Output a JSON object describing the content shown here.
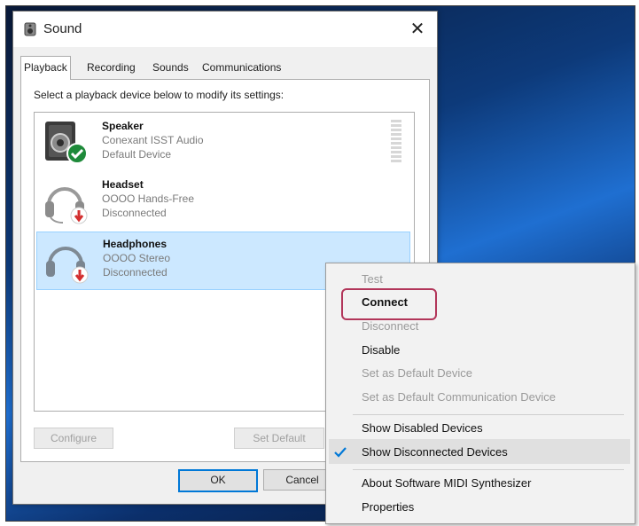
{
  "dialog": {
    "title": "Sound",
    "close_glyph": "✕",
    "tabs": [
      {
        "label": "Playback",
        "active": true
      },
      {
        "label": "Recording",
        "active": false
      },
      {
        "label": "Sounds",
        "active": false
      },
      {
        "label": "Communications",
        "active": false
      }
    ],
    "instruction": "Select a playback device below to modify its settings:",
    "devices": [
      {
        "name": "Speaker",
        "driver": "Conexant ISST Audio",
        "status": "Default Device",
        "icon": "speaker-icon",
        "badge": "default-check-badge",
        "selected": false
      },
      {
        "name": "Headset",
        "driver": "OOOO Hands-Free",
        "status": "Disconnected",
        "icon": "headset-icon",
        "badge": "disconnected-arrow-badge",
        "selected": false
      },
      {
        "name": "Headphones",
        "driver": "OOOO Stereo",
        "status": "Disconnected",
        "icon": "headphones-icon",
        "badge": "disconnected-arrow-badge",
        "selected": true
      }
    ],
    "buttons": {
      "configure": "Configure",
      "set_default": "Set Default",
      "ok": "OK",
      "cancel": "Cancel"
    }
  },
  "context_menu": {
    "items": [
      {
        "label": "Test",
        "state": "disabled"
      },
      {
        "label": "Connect",
        "state": "enabled",
        "highlighted": true
      },
      {
        "label": "Disconnect",
        "state": "disabled"
      },
      {
        "label": "Disable",
        "state": "enabled"
      },
      {
        "label": "Set as Default Device",
        "state": "disabled"
      },
      {
        "label": "Set as Default Communication Device",
        "state": "disabled"
      },
      {
        "label": "Show Disabled Devices",
        "state": "enabled"
      },
      {
        "label": "Show Disconnected Devices",
        "state": "checked"
      },
      {
        "label": "About Software MIDI Synthesizer",
        "state": "enabled"
      },
      {
        "label": "Properties",
        "state": "enabled"
      }
    ]
  },
  "colors": {
    "accent": "#0078d7",
    "highlight_ring": "#b2365a",
    "selected_row": "#cce8ff",
    "ok_badge": "#1e8a3a",
    "disconnected_badge": "#d32f2f"
  }
}
